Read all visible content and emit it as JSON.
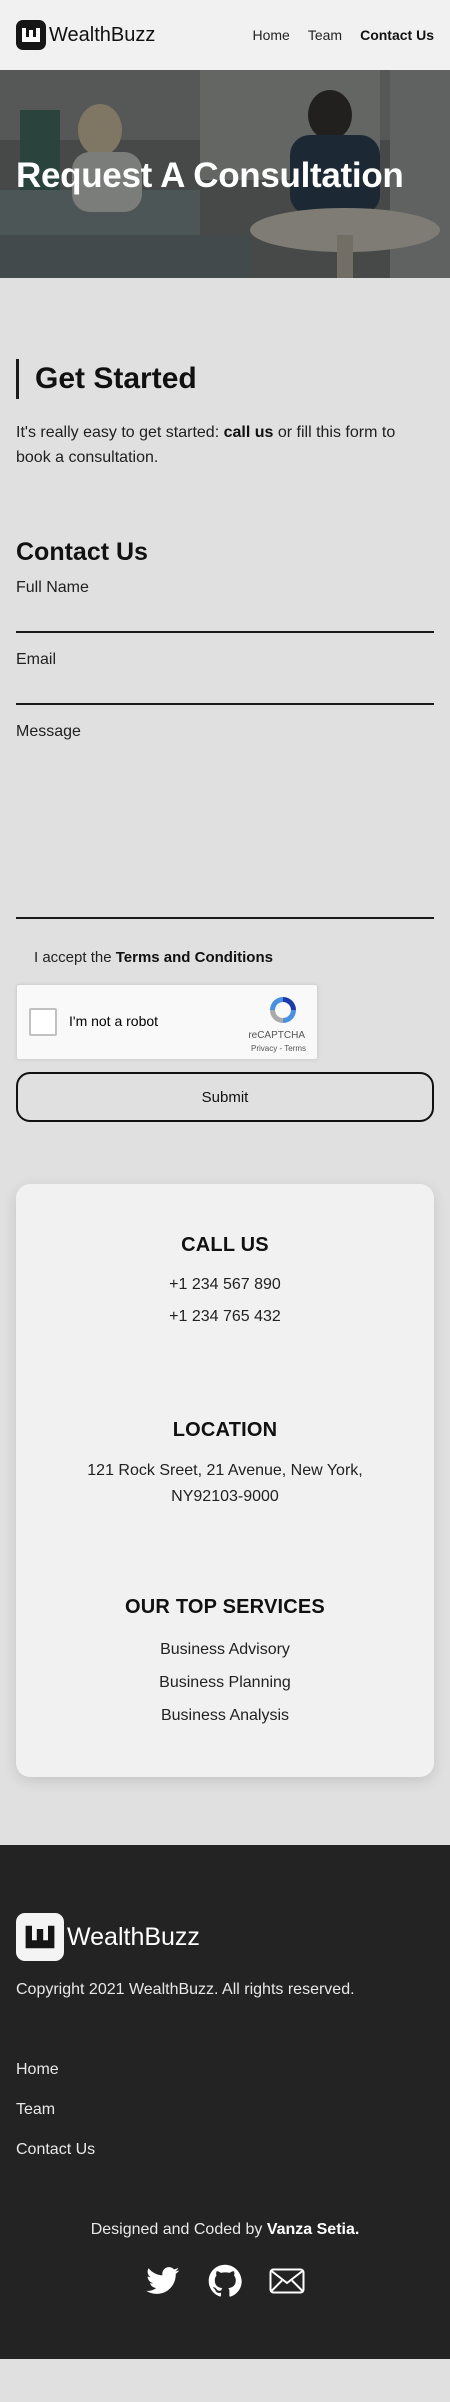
{
  "header": {
    "brand": "WealthBuzz",
    "logo_letter": "w",
    "nav": [
      {
        "label": "Home"
      },
      {
        "label": "Team"
      },
      {
        "label": "Contact Us",
        "active": true
      }
    ]
  },
  "hero": {
    "title": "Request A Consultation"
  },
  "get_started": {
    "heading": "Get Started",
    "intro_prefix": "It's really easy to get started: ",
    "intro_bold": "call us",
    "intro_suffix": " or fill this form to book a consultation."
  },
  "form": {
    "title": "Contact Us",
    "full_name_label": "Full Name",
    "full_name_value": "",
    "email_label": "Email",
    "email_value": "",
    "message_label": "Message",
    "message_value": "",
    "terms_prefix": "I accept the ",
    "terms_link": "Terms and Conditions",
    "terms_checked": false,
    "captcha": {
      "label": "I'm not a robot",
      "brand": "reCAPTCHA",
      "privacy": "Privacy",
      "separator": " - ",
      "terms": "Terms",
      "checked": false
    },
    "submit_label": "Submit"
  },
  "info": {
    "call_title": "CALL US",
    "phones": [
      "+1 234 567 890",
      "+1 234 765 432"
    ],
    "location_title": "LOCATION",
    "address": "121 Rock Sreet, 21 Avenue, New York, NY92103-9000",
    "services_title": "OUR TOP SERVICES",
    "services": [
      "Business Advisory",
      "Business Planning",
      "Business Analysis"
    ]
  },
  "footer": {
    "brand": "WealthBuzz",
    "copyright": "Copyright 2021 WealthBuzz. All rights reserved.",
    "nav": [
      {
        "label": "Home"
      },
      {
        "label": "Team"
      },
      {
        "label": "Contact Us"
      }
    ],
    "credit_prefix": "Designed and Coded by ",
    "credit_name": "Vanza Setia.",
    "socials": [
      {
        "icon": "twitter-icon"
      },
      {
        "icon": "github-icon"
      },
      {
        "icon": "mail-icon"
      }
    ]
  },
  "colors": {
    "page_bg": "#e0e0e0",
    "header_bg": "#f1f1f1",
    "card_bg": "#f1f1f1",
    "footer_bg": "#232323",
    "text": "#1a1a1a",
    "captcha_blue": "#4a90e2"
  }
}
